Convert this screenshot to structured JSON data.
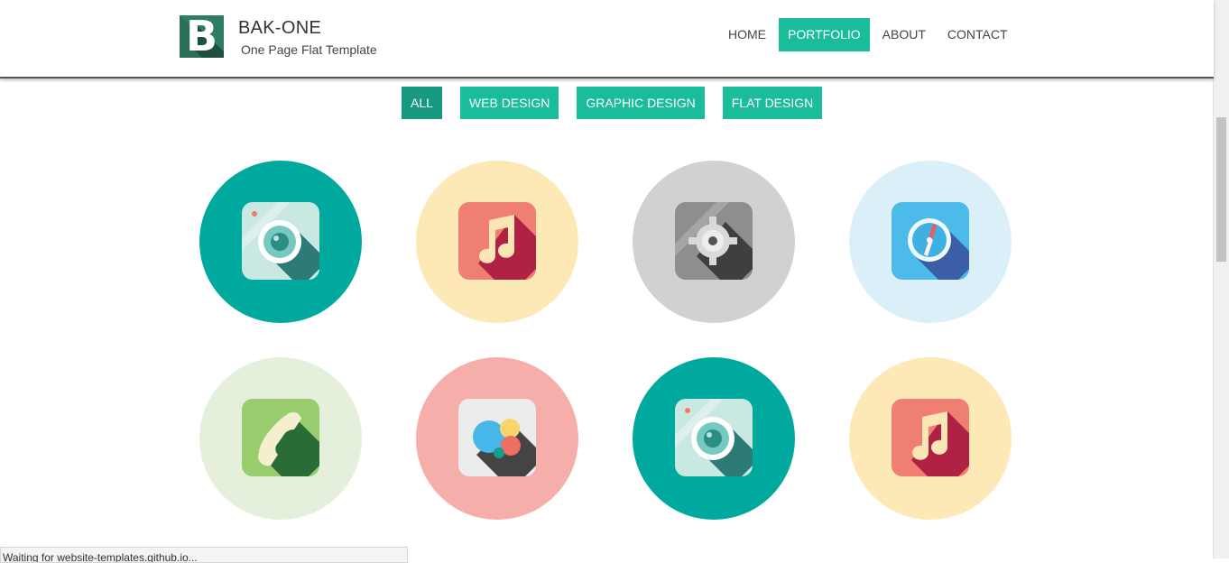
{
  "brand": {
    "logo_letter": "B",
    "title": "BAK-ONE",
    "subtitle": "One Page Flat Template"
  },
  "nav": {
    "items": [
      {
        "label": "HOME",
        "active": false
      },
      {
        "label": "PORTFOLIO",
        "active": true
      },
      {
        "label": "ABOUT",
        "active": false
      },
      {
        "label": "CONTACT",
        "active": false
      }
    ]
  },
  "filters": [
    {
      "label": "ALL",
      "active": true
    },
    {
      "label": "WEB DESIGN",
      "active": false
    },
    {
      "label": "GRAPHIC DESIGN",
      "active": false
    },
    {
      "label": "FLAT DESIGN",
      "active": false
    }
  ],
  "portfolio": {
    "items": [
      {
        "icon": "camera-icon",
        "bg": "#00a99d"
      },
      {
        "icon": "music-icon",
        "bg": "#fde9b6"
      },
      {
        "icon": "settings-icon",
        "bg": "#d1d1d3"
      },
      {
        "icon": "compass-icon",
        "bg": "#dbeff8"
      },
      {
        "icon": "phone-icon",
        "bg": "#e5f0dc"
      },
      {
        "icon": "chat-bubbles-icon",
        "bg": "#f6aeaa"
      },
      {
        "icon": "camera-icon",
        "bg": "#00a99d"
      },
      {
        "icon": "music-icon",
        "bg": "#fde9b6"
      }
    ]
  },
  "status_bar": {
    "text": "Waiting for website-templates.github.io..."
  },
  "colors": {
    "accent": "#1abc9c",
    "accent_active": "#16997e"
  }
}
